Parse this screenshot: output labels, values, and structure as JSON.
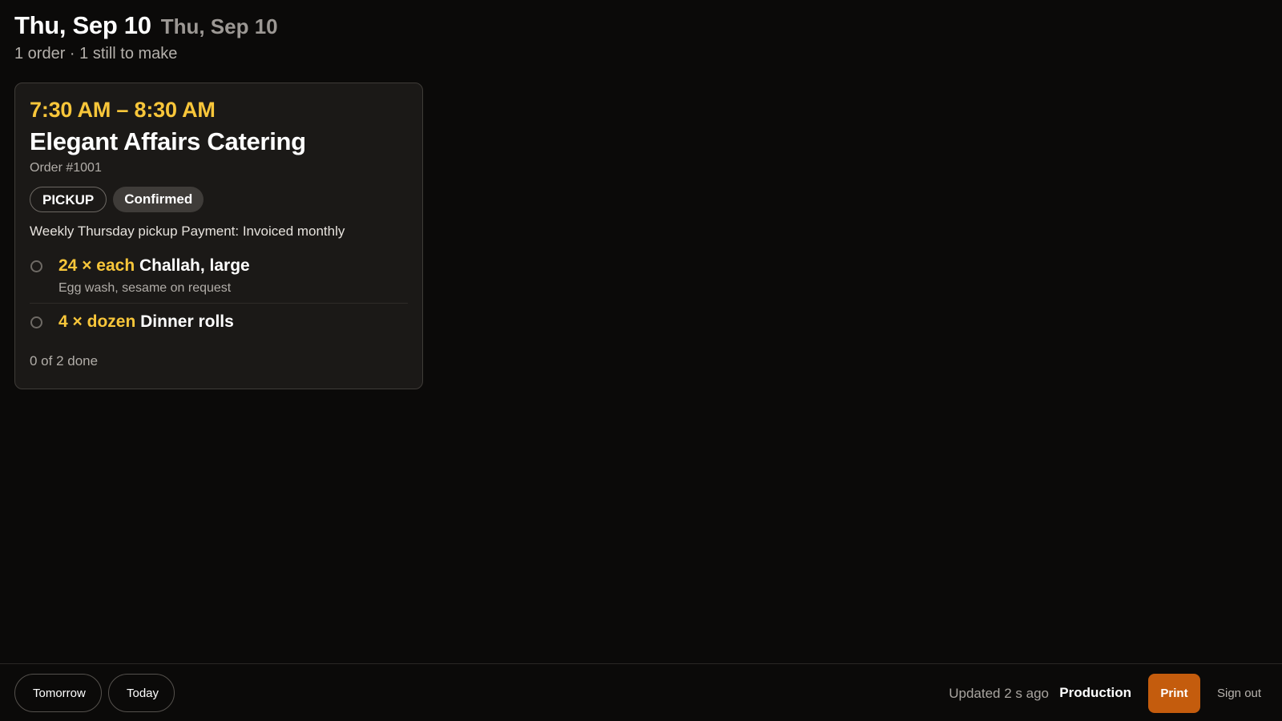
{
  "header": {
    "title": "Thu, Sep 10",
    "subtitle": "Thu, Sep 10",
    "summary": "1 order · 1 still to make"
  },
  "order": {
    "time_range": "7:30 AM – 8:30 AM",
    "customer": "Elegant Affairs Catering",
    "order_number": "Order #1001",
    "type_badge": "PICKUP",
    "status_badge": "Confirmed",
    "notes": "Weekly Thursday pickup Payment: Invoiced monthly",
    "items": [
      {
        "quantity": "24 × each",
        "name": "Challah, large",
        "note": "Egg wash, sesame on request",
        "done": false
      },
      {
        "quantity": "4 × dozen",
        "name": "Dinner rolls",
        "note": "",
        "done": false
      }
    ],
    "progress": "0 of 2 done"
  },
  "footer": {
    "tomorrow_label": "Tomorrow",
    "today_label": "Today",
    "updated_text": "Updated 2 s ago",
    "production_label": "Production",
    "print_label": "Print",
    "signout_label": "Sign out"
  },
  "colors": {
    "background": "#0b0a09",
    "card_background": "#1b1917",
    "accent_yellow": "#f8c63a",
    "print_button": "#c45c0d",
    "status_badge": "#3f3c39"
  },
  "icons": {
    "item_check": "radio-circle-icon"
  }
}
